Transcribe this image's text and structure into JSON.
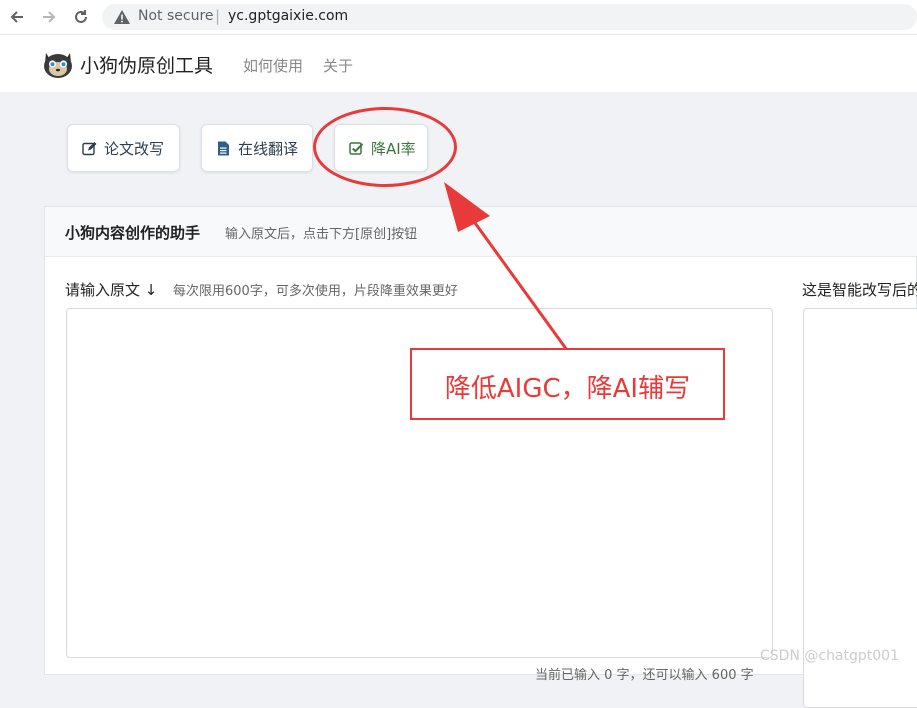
{
  "browser": {
    "security": "Not secure",
    "separator": "|",
    "url": "yc.gptgaixie.com"
  },
  "header": {
    "brand": "小狗伪原创工具",
    "nav": [
      "如何使用",
      "关于"
    ]
  },
  "tools": [
    {
      "label": "论文改写",
      "icon": "edit-icon"
    },
    {
      "label": "在线翻译",
      "icon": "document-icon"
    },
    {
      "label": "降AI率",
      "icon": "check-square-icon"
    }
  ],
  "card": {
    "title": "小狗内容创作的助手",
    "subtitle": "输入原文后，点击下方[原创]按钮",
    "input_label": "请输入原文 ↓",
    "input_hint": "每次限用600字，可多次使用，片段降重效果更好",
    "output_label": "这是智能改写后的",
    "counter": "当前已输入 0 字，还可以输入 600 字"
  },
  "annotation": {
    "callout": "降低AIGC，降AI辅写"
  },
  "watermark": "CSDN @chatgpt001",
  "colors": {
    "accent_red": "#e83a3a",
    "btn_text": "#2c3e50",
    "reduce_text": "#3c763d",
    "page_bg": "#f0f2f5"
  }
}
